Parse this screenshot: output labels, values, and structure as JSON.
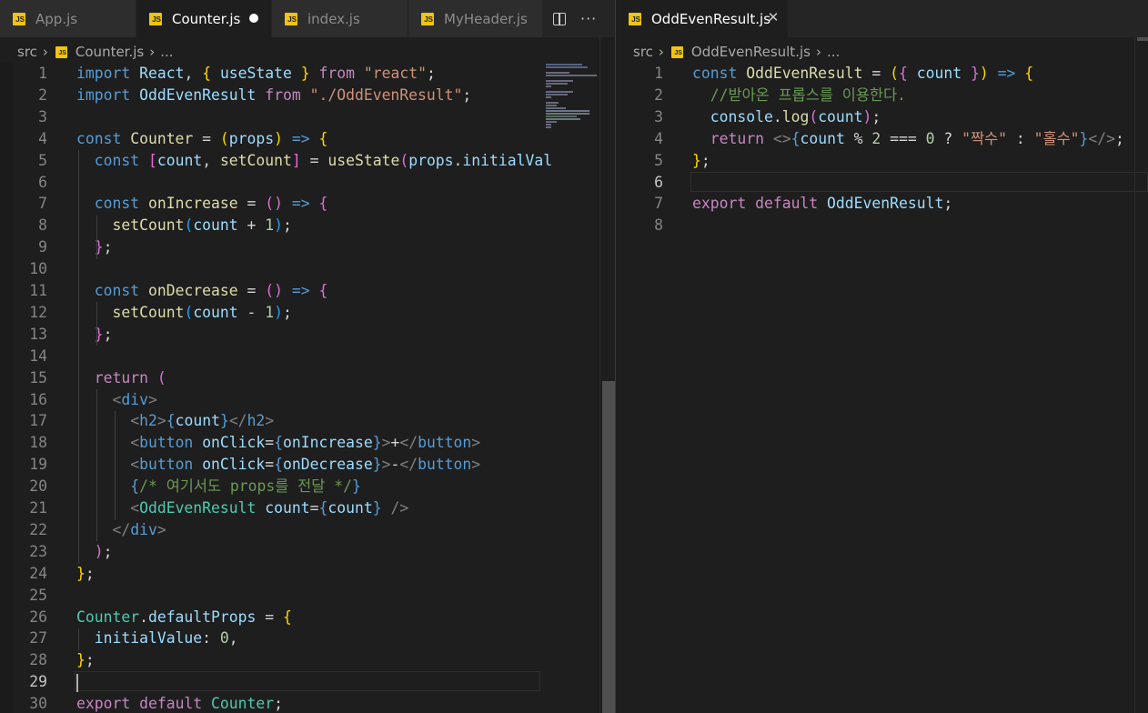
{
  "left": {
    "tabs": [
      {
        "label": "App.js",
        "active": false,
        "modified": false
      },
      {
        "label": "Counter.js",
        "active": true,
        "modified": true
      },
      {
        "label": "index.js",
        "active": false,
        "modified": false
      },
      {
        "label": "MyHeader.js",
        "active": false,
        "modified": false
      }
    ],
    "breadcrumb": {
      "folder": "src",
      "file": "Counter.js",
      "tail": "..."
    },
    "current_line": 29,
    "lines": [
      {
        "n": "1",
        "t": [
          [
            "kw",
            "import"
          ],
          [
            "txt",
            " "
          ],
          [
            "var",
            "React"
          ],
          [
            "txt",
            ", "
          ],
          [
            "b1",
            "{"
          ],
          [
            "txt",
            " "
          ],
          [
            "var",
            "useState"
          ],
          [
            "txt",
            " "
          ],
          [
            "b1",
            "}"
          ],
          [
            "txt",
            " "
          ],
          [
            "ctl",
            "from"
          ],
          [
            "txt",
            " "
          ],
          [
            "str",
            "\"react\""
          ],
          [
            "txt",
            ";"
          ]
        ]
      },
      {
        "n": "2",
        "t": [
          [
            "kw",
            "import"
          ],
          [
            "txt",
            " "
          ],
          [
            "var",
            "OddEvenResult"
          ],
          [
            "txt",
            " "
          ],
          [
            "ctl",
            "from"
          ],
          [
            "txt",
            " "
          ],
          [
            "str",
            "\"./OddEvenResult\""
          ],
          [
            "txt",
            ";"
          ]
        ]
      },
      {
        "n": "3",
        "t": []
      },
      {
        "n": "4",
        "t": [
          [
            "kw",
            "const"
          ],
          [
            "txt",
            " "
          ],
          [
            "fn",
            "Counter"
          ],
          [
            "txt",
            " = "
          ],
          [
            "b1",
            "("
          ],
          [
            "var",
            "props"
          ],
          [
            "b1",
            ")"
          ],
          [
            "txt",
            " "
          ],
          [
            "kw",
            "=>"
          ],
          [
            "txt",
            " "
          ],
          [
            "b1",
            "{"
          ]
        ]
      },
      {
        "n": "5",
        "t": [
          [
            "txt",
            "  "
          ],
          [
            "kw",
            "const"
          ],
          [
            "txt",
            " "
          ],
          [
            "b2",
            "["
          ],
          [
            "var",
            "count"
          ],
          [
            "txt",
            ", "
          ],
          [
            "fn",
            "setCount"
          ],
          [
            "b2",
            "]"
          ],
          [
            "txt",
            " = "
          ],
          [
            "fn",
            "useState"
          ],
          [
            "b2",
            "("
          ],
          [
            "var",
            "props"
          ],
          [
            "txt",
            "."
          ],
          [
            "var",
            "initialVal"
          ]
        ]
      },
      {
        "n": "6",
        "t": []
      },
      {
        "n": "7",
        "t": [
          [
            "txt",
            "  "
          ],
          [
            "kw",
            "const"
          ],
          [
            "txt",
            " "
          ],
          [
            "fn",
            "onIncrease"
          ],
          [
            "txt",
            " = "
          ],
          [
            "b2",
            "()"
          ],
          [
            "txt",
            " "
          ],
          [
            "kw",
            "=>"
          ],
          [
            "txt",
            " "
          ],
          [
            "b2",
            "{"
          ]
        ]
      },
      {
        "n": "8",
        "t": [
          [
            "txt",
            "    "
          ],
          [
            "fn",
            "setCount"
          ],
          [
            "b3",
            "("
          ],
          [
            "var",
            "count"
          ],
          [
            "txt",
            " + "
          ],
          [
            "num",
            "1"
          ],
          [
            "b3",
            ")"
          ],
          [
            "txt",
            ";"
          ]
        ]
      },
      {
        "n": "9",
        "t": [
          [
            "txt",
            "  "
          ],
          [
            "b2",
            "}"
          ],
          [
            "txt",
            ";"
          ]
        ]
      },
      {
        "n": "10",
        "t": []
      },
      {
        "n": "11",
        "t": [
          [
            "txt",
            "  "
          ],
          [
            "kw",
            "const"
          ],
          [
            "txt",
            " "
          ],
          [
            "fn",
            "onDecrease"
          ],
          [
            "txt",
            " = "
          ],
          [
            "b2",
            "()"
          ],
          [
            "txt",
            " "
          ],
          [
            "kw",
            "=>"
          ],
          [
            "txt",
            " "
          ],
          [
            "b2",
            "{"
          ]
        ]
      },
      {
        "n": "12",
        "t": [
          [
            "txt",
            "    "
          ],
          [
            "fn",
            "setCount"
          ],
          [
            "b3",
            "("
          ],
          [
            "var",
            "count"
          ],
          [
            "txt",
            " - "
          ],
          [
            "num",
            "1"
          ],
          [
            "b3",
            ")"
          ],
          [
            "txt",
            ";"
          ]
        ]
      },
      {
        "n": "13",
        "t": [
          [
            "txt",
            "  "
          ],
          [
            "b2",
            "}"
          ],
          [
            "txt",
            ";"
          ]
        ]
      },
      {
        "n": "14",
        "t": []
      },
      {
        "n": "15",
        "t": [
          [
            "txt",
            "  "
          ],
          [
            "ctl",
            "return"
          ],
          [
            "txt",
            " "
          ],
          [
            "b2",
            "("
          ]
        ]
      },
      {
        "n": "16",
        "t": [
          [
            "txt",
            "    "
          ],
          [
            "pun",
            "<"
          ],
          [
            "tag",
            "div"
          ],
          [
            "pun",
            ">"
          ]
        ]
      },
      {
        "n": "17",
        "t": [
          [
            "txt",
            "      "
          ],
          [
            "pun",
            "<"
          ],
          [
            "tag",
            "h2"
          ],
          [
            "pun",
            ">"
          ],
          [
            "kw",
            "{"
          ],
          [
            "var",
            "count"
          ],
          [
            "kw",
            "}"
          ],
          [
            "pun",
            "</"
          ],
          [
            "tag",
            "h2"
          ],
          [
            "pun",
            ">"
          ]
        ]
      },
      {
        "n": "18",
        "t": [
          [
            "txt",
            "      "
          ],
          [
            "pun",
            "<"
          ],
          [
            "tag",
            "button"
          ],
          [
            "txt",
            " "
          ],
          [
            "var",
            "onClick"
          ],
          [
            "txt",
            "="
          ],
          [
            "kw",
            "{"
          ],
          [
            "var",
            "onIncrease"
          ],
          [
            "kw",
            "}"
          ],
          [
            "pun",
            ">"
          ],
          [
            "txt",
            "+"
          ],
          [
            "pun",
            "</"
          ],
          [
            "tag",
            "button"
          ],
          [
            "pun",
            ">"
          ]
        ]
      },
      {
        "n": "19",
        "t": [
          [
            "txt",
            "      "
          ],
          [
            "pun",
            "<"
          ],
          [
            "tag",
            "button"
          ],
          [
            "txt",
            " "
          ],
          [
            "var",
            "onClick"
          ],
          [
            "txt",
            "="
          ],
          [
            "kw",
            "{"
          ],
          [
            "var",
            "onDecrease"
          ],
          [
            "kw",
            "}"
          ],
          [
            "pun",
            ">"
          ],
          [
            "txt",
            "-"
          ],
          [
            "pun",
            "</"
          ],
          [
            "tag",
            "button"
          ],
          [
            "pun",
            ">"
          ]
        ]
      },
      {
        "n": "20",
        "t": [
          [
            "txt",
            "      "
          ],
          [
            "kw",
            "{"
          ],
          [
            "cmt",
            "/* 여기서도 props를 전달 */"
          ],
          [
            "kw",
            "}"
          ]
        ]
      },
      {
        "n": "21",
        "t": [
          [
            "txt",
            "      "
          ],
          [
            "pun",
            "<"
          ],
          [
            "cls",
            "OddEvenResult"
          ],
          [
            "txt",
            " "
          ],
          [
            "var",
            "count"
          ],
          [
            "txt",
            "="
          ],
          [
            "kw",
            "{"
          ],
          [
            "var",
            "count"
          ],
          [
            "kw",
            "}"
          ],
          [
            "txt",
            " "
          ],
          [
            "pun",
            "/>"
          ]
        ]
      },
      {
        "n": "22",
        "t": [
          [
            "txt",
            "    "
          ],
          [
            "pun",
            "</"
          ],
          [
            "tag",
            "div"
          ],
          [
            "pun",
            ">"
          ]
        ]
      },
      {
        "n": "23",
        "t": [
          [
            "txt",
            "  "
          ],
          [
            "b2",
            ")"
          ],
          [
            "txt",
            ";"
          ]
        ]
      },
      {
        "n": "24",
        "t": [
          [
            "b1",
            "}"
          ],
          [
            "txt",
            ";"
          ]
        ]
      },
      {
        "n": "25",
        "t": []
      },
      {
        "n": "26",
        "t": [
          [
            "cls",
            "Counter"
          ],
          [
            "txt",
            "."
          ],
          [
            "var",
            "defaultProps"
          ],
          [
            "txt",
            " = "
          ],
          [
            "b1",
            "{"
          ]
        ]
      },
      {
        "n": "27",
        "t": [
          [
            "txt",
            "  "
          ],
          [
            "var",
            "initialValue"
          ],
          [
            "txt",
            ": "
          ],
          [
            "num",
            "0"
          ],
          [
            "txt",
            ","
          ]
        ]
      },
      {
        "n": "28",
        "t": [
          [
            "b1",
            "}"
          ],
          [
            "txt",
            ";"
          ]
        ]
      },
      {
        "n": "29",
        "t": []
      },
      {
        "n": "30",
        "t": [
          [
            "ctl",
            "export"
          ],
          [
            "txt",
            " "
          ],
          [
            "ctl",
            "default"
          ],
          [
            "txt",
            " "
          ],
          [
            "cls",
            "Counter"
          ],
          [
            "txt",
            ";"
          ]
        ]
      }
    ]
  },
  "right": {
    "tabs": [
      {
        "label": "OddEvenResult.js",
        "active": true,
        "modified": false
      }
    ],
    "breadcrumb": {
      "folder": "src",
      "file": "OddEvenResult.js",
      "tail": "..."
    },
    "current_line": 6,
    "lines": [
      {
        "n": "1",
        "t": [
          [
            "kw",
            "const"
          ],
          [
            "txt",
            " "
          ],
          [
            "fn",
            "OddEvenResult"
          ],
          [
            "txt",
            " = "
          ],
          [
            "b1",
            "("
          ],
          [
            "b2",
            "{"
          ],
          [
            "txt",
            " "
          ],
          [
            "var",
            "count"
          ],
          [
            "txt",
            " "
          ],
          [
            "b2",
            "}"
          ],
          [
            "b1",
            ")"
          ],
          [
            "txt",
            " "
          ],
          [
            "kw",
            "=>"
          ],
          [
            "txt",
            " "
          ],
          [
            "b1",
            "{"
          ]
        ]
      },
      {
        "n": "2",
        "t": [
          [
            "txt",
            "  "
          ],
          [
            "cmt",
            "//받아온 프롭스를 이용한다."
          ]
        ]
      },
      {
        "n": "3",
        "t": [
          [
            "txt",
            "  "
          ],
          [
            "var",
            "console"
          ],
          [
            "txt",
            "."
          ],
          [
            "fn",
            "log"
          ],
          [
            "b2",
            "("
          ],
          [
            "var",
            "count"
          ],
          [
            "b2",
            ")"
          ],
          [
            "txt",
            ";"
          ]
        ]
      },
      {
        "n": "4",
        "t": [
          [
            "txt",
            "  "
          ],
          [
            "ctl",
            "return"
          ],
          [
            "txt",
            " "
          ],
          [
            "pun",
            "<>"
          ],
          [
            "kw",
            "{"
          ],
          [
            "var",
            "count"
          ],
          [
            "txt",
            " % "
          ],
          [
            "num",
            "2"
          ],
          [
            "txt",
            " === "
          ],
          [
            "num",
            "0"
          ],
          [
            "txt",
            " ? "
          ],
          [
            "str",
            "\"짝수\""
          ],
          [
            "txt",
            " : "
          ],
          [
            "str",
            "\"홀수\""
          ],
          [
            "kw",
            "}"
          ],
          [
            "pun",
            "</>"
          ],
          [
            "txt",
            ";"
          ]
        ]
      },
      {
        "n": "5",
        "t": [
          [
            "b1",
            "}"
          ],
          [
            "txt",
            ";"
          ]
        ]
      },
      {
        "n": "6",
        "t": []
      },
      {
        "n": "7",
        "t": [
          [
            "ctl",
            "export"
          ],
          [
            "txt",
            " "
          ],
          [
            "ctl",
            "default"
          ],
          [
            "txt",
            " "
          ],
          [
            "var",
            "OddEvenResult"
          ],
          [
            "txt",
            ";"
          ]
        ]
      },
      {
        "n": "8",
        "t": []
      }
    ]
  },
  "icons": {
    "js": "JS",
    "close": "✕"
  }
}
